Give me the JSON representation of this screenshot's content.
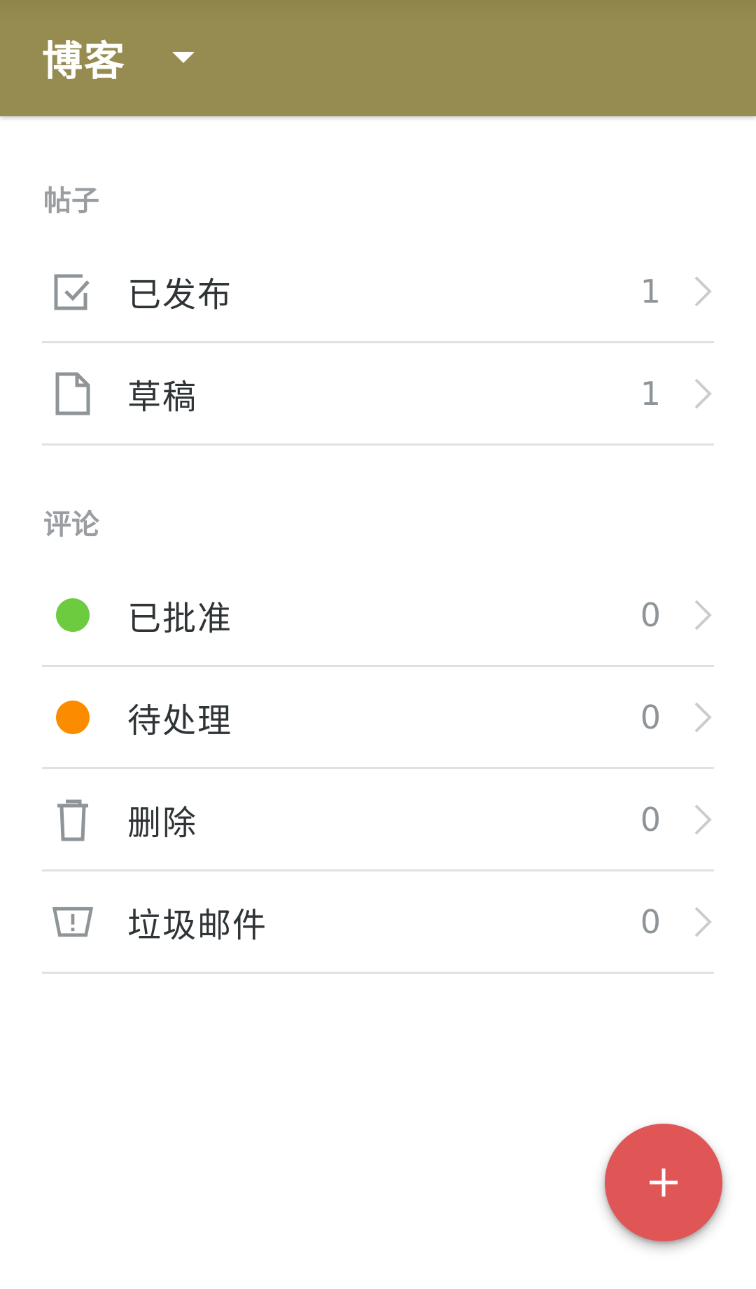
{
  "app_bar": {
    "title": "博客",
    "dropdown_icon": "caret-down-icon",
    "background_color": "#968c50"
  },
  "sections": {
    "posts": {
      "header": "帖子",
      "items": [
        {
          "label": "已发布",
          "count": "1",
          "icon": "check-square-icon"
        },
        {
          "label": "草稿",
          "count": "1",
          "icon": "document-icon"
        }
      ]
    },
    "comments": {
      "header": "评论",
      "items": [
        {
          "label": "已批准",
          "count": "0",
          "icon": "green-dot-icon",
          "color": "#6ccb3f"
        },
        {
          "label": "待处理",
          "count": "0",
          "icon": "orange-dot-icon",
          "color": "#fb8c00"
        },
        {
          "label": "删除",
          "count": "0",
          "icon": "trash-icon"
        },
        {
          "label": "垃圾邮件",
          "count": "0",
          "icon": "spam-icon"
        }
      ]
    }
  },
  "fab": {
    "icon": "plus-icon",
    "color": "#e05555"
  },
  "colors": {
    "divider": "#dfe2e4",
    "section_header": "#9a9ea2",
    "icon_gray": "#8e9498"
  }
}
